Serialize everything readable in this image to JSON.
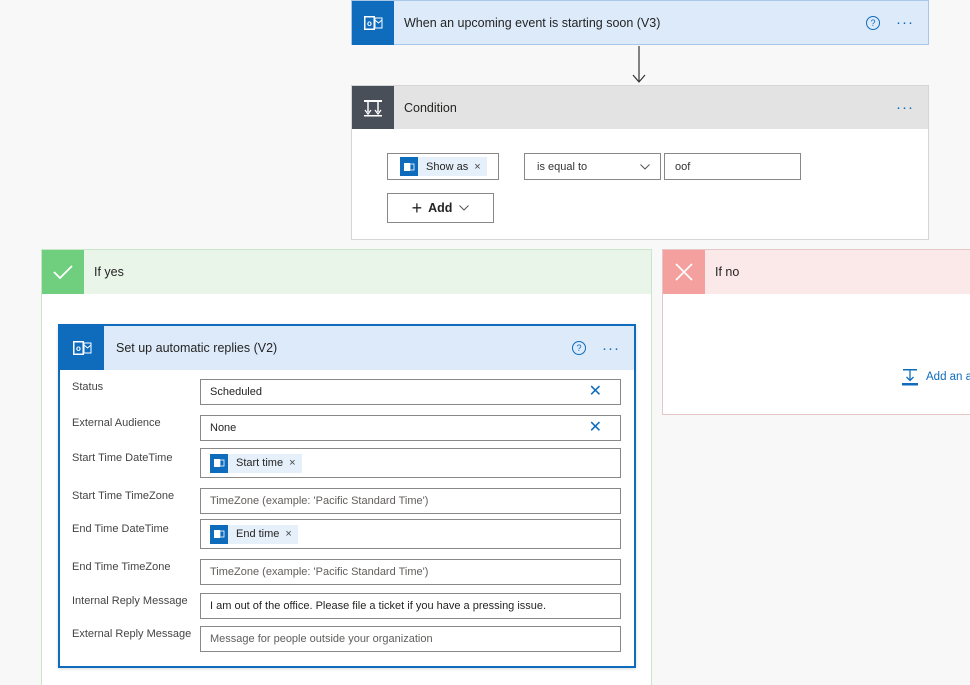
{
  "trigger": {
    "title": "When an upcoming event is starting soon (V3)",
    "icon": "outlook-icon",
    "help_icon": "?",
    "more_label": "···"
  },
  "condition": {
    "title": "Condition",
    "more_label": "···",
    "token": {
      "label": "Show as",
      "remove": "×"
    },
    "operator": "is equal to",
    "value": "oof",
    "add_label": "Add"
  },
  "if_yes": {
    "title": "If yes",
    "color": "#6fcf7f"
  },
  "if_no": {
    "title": "If no",
    "color": "#f4a09e",
    "add_action_label": "Add an a"
  },
  "action": {
    "title": "Set up automatic replies (V2)",
    "help_icon": "?",
    "more_label": "···",
    "fields": {
      "status": {
        "label": "Status",
        "value": "Scheduled"
      },
      "external_audience": {
        "label": "External Audience",
        "value": "None"
      },
      "start_datetime": {
        "label": "Start Time DateTime",
        "token": "Start time"
      },
      "start_timezone": {
        "label": "Start Time TimeZone",
        "placeholder": "TimeZone (example: 'Pacific Standard Time')"
      },
      "end_datetime": {
        "label": "End Time DateTime",
        "token": "End time"
      },
      "end_timezone": {
        "label": "End Time TimeZone",
        "placeholder": "TimeZone (example: 'Pacific Standard Time')"
      },
      "internal_reply": {
        "label": "Internal Reply Message",
        "value": "I am out of the office. Please file a ticket if you have a pressing issue."
      },
      "external_reply": {
        "label": "External Reply Message",
        "placeholder": "Message for people outside your organization"
      }
    },
    "token_remove": "×",
    "clear": "✕"
  },
  "colors": {
    "accent": "#0f6cbd",
    "condition_icon_bg": "#484f58"
  }
}
